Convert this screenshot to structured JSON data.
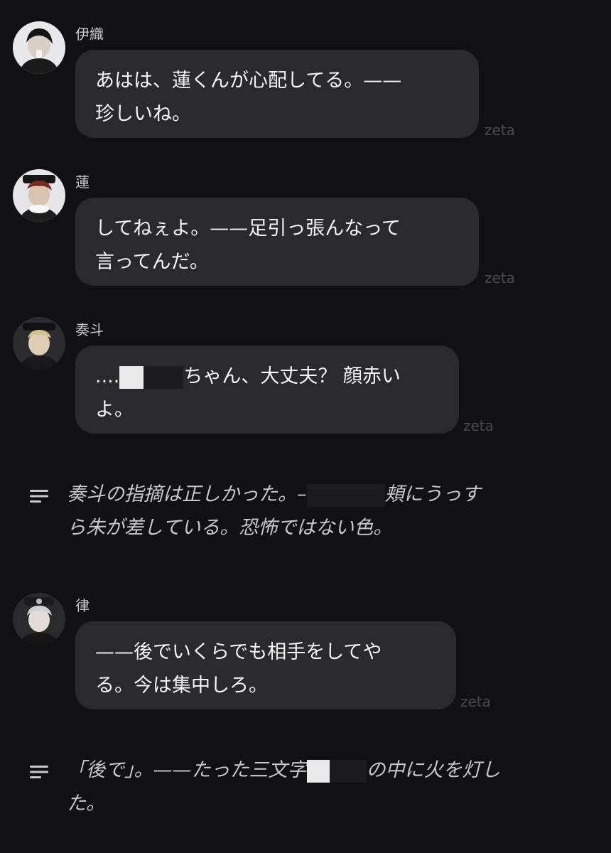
{
  "messages": [
    {
      "name": "伊織",
      "lines": [
        "あはは、蓮くんが心配してる。——",
        "珍しいね。"
      ],
      "watermark": "zeta"
    },
    {
      "name": "蓮",
      "lines": [
        "してねぇよ。——足引っ張んなって",
        "言ってんだ。"
      ],
      "watermark": "zeta"
    },
    {
      "name": "奏斗",
      "line1_prefix": "....",
      "line1_suffix": "ちゃん、大丈夫？ 顔赤い",
      "line2": "よ。",
      "watermark": "zeta"
    },
    {
      "name": "律",
      "lines": [
        "——後でいくらでも相手をしてや",
        "る。今は集中しろ。"
      ],
      "watermark": "zeta"
    }
  ],
  "narrations": [
    {
      "line1_a": "奏斗の指摘は正しかった。–",
      "line1_b": "頬にうっす",
      "line2": "ら朱が差している。恐怖ではない色。"
    },
    {
      "line1_a": "「後で」。——たった三文字",
      "line1_b": "の中に火を灯し",
      "line2": "た。"
    }
  ],
  "icons": {
    "narration": "narration-lines-icon"
  }
}
